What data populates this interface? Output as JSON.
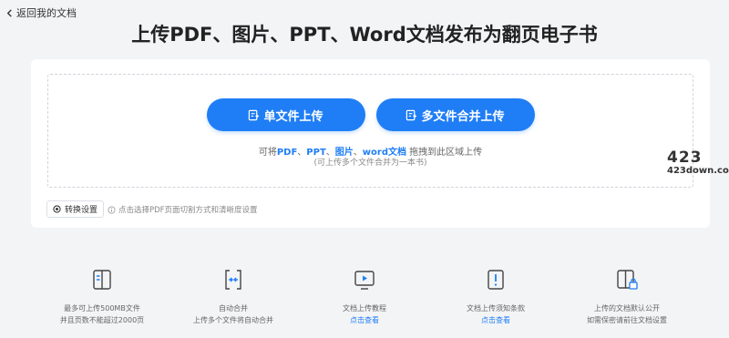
{
  "header": {
    "back_label": "返回我的文档",
    "title_parts": [
      "上传",
      "PDF",
      "、",
      "图片",
      "、",
      "PPT",
      "、",
      "Word文档",
      "发布为翻页电子书"
    ]
  },
  "upload": {
    "single_label": "单文件上传",
    "multi_label": "多文件合并上传",
    "hint_prefix": "可将",
    "hint_pdf": "PDF",
    "hint_sep1": "、",
    "hint_ppt": "PPT",
    "hint_sep2": "、",
    "hint_img": "图片",
    "hint_sep3": "、",
    "hint_word": "word文档",
    "hint_suffix": " 拖拽到此区域上传",
    "hint_sub": "(可上传多个文件合并为一本书)"
  },
  "settings": {
    "button_label": "转换设置",
    "tip": "点击选择PDF页面切割方式和清晰度设置"
  },
  "watermark": {
    "number": "423",
    "site": "423down.com"
  },
  "features": [
    {
      "icon": "book-icon",
      "line1": "最多可上传500MB文件",
      "line2": "并且页数不能超过2000页",
      "link": false
    },
    {
      "icon": "merge-icon",
      "line1": "自动合并",
      "line2": "上传多个文件将自动合并",
      "link": false
    },
    {
      "icon": "video-icon",
      "line1": "文档上传教程",
      "line2": "点击查看",
      "link": true
    },
    {
      "icon": "notice-icon",
      "line1": "文档上传须知条款",
      "line2": "点击查看",
      "link": true
    },
    {
      "icon": "lock-book-icon",
      "line1": "上传的文档默认公开",
      "line2": "如需保密请前往文档设置",
      "link": false
    }
  ],
  "colors": {
    "accent": "#1f7ef5",
    "background": "#f3f4f6"
  }
}
